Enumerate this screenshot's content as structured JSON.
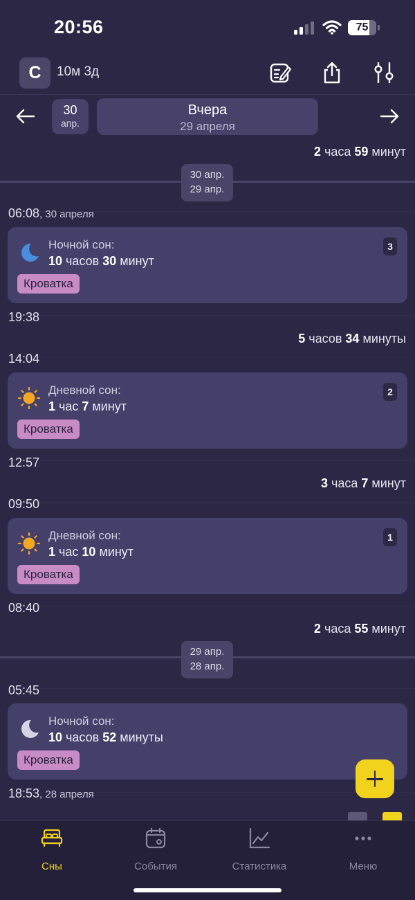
{
  "status_bar": {
    "time": "20:56",
    "battery": "75",
    "battery_level": 0.75
  },
  "header": {
    "avatar_letter": "С",
    "age": "10м 3д",
    "icons": [
      "edit-note-icon",
      "share-icon",
      "sliders-icon"
    ]
  },
  "date_nav": {
    "prev_day_num": "30",
    "prev_day_month": "апр.",
    "day_title": "Вчера",
    "day_date": "29 апреля"
  },
  "timeline": {
    "top_duration": {
      "num1": "2",
      "unit1": " часа ",
      "num2": "59",
      "unit2": " минут"
    },
    "divider1": {
      "top": "30 апр.",
      "bottom": "29 апр."
    },
    "divider2": {
      "top": "29 апр.",
      "bottom": "28 апр."
    },
    "times": [
      {
        "time": "06:08",
        "date": ", 30 апреля"
      },
      {
        "time": "19:38",
        "date": ""
      },
      {
        "time": "14:04",
        "date": ""
      },
      {
        "time": "12:57",
        "date": ""
      },
      {
        "time": "09:50",
        "date": ""
      },
      {
        "time": "08:40",
        "date": ""
      },
      {
        "time": "05:45",
        "date": ""
      },
      {
        "time": "18:53",
        "date": ", 28 апреля"
      }
    ],
    "gaps": [
      {
        "num1": "5",
        "unit1": " часов ",
        "num2": "34",
        "unit2": " минуты"
      },
      {
        "num1": "3",
        "unit1": " часа ",
        "num2": "7",
        "unit2": " минут"
      },
      {
        "num1": "2",
        "unit1": " часа ",
        "num2": "55",
        "unit2": " минут"
      }
    ],
    "cards": [
      {
        "kind": "Ночной сон:",
        "num1": "10",
        "unit1": " часов ",
        "num2": "30",
        "unit2": " минут",
        "tag": "Кроватка",
        "index": "3",
        "icon": "moon-icon"
      },
      {
        "kind": "Дневной сон:",
        "num1": "1",
        "unit1": " час ",
        "num2": "7",
        "unit2": " минут",
        "tag": "Кроватка",
        "index": "2",
        "icon": "sun-icon"
      },
      {
        "kind": "Дневной сон:",
        "num1": "1",
        "unit1": " час ",
        "num2": "10",
        "unit2": " минут",
        "tag": "Кроватка",
        "index": "1",
        "icon": "sun-icon"
      },
      {
        "kind": "Ночной сон:",
        "num1": "10",
        "unit1": " часов ",
        "num2": "52",
        "unit2": " минуты",
        "tag": "Кроватка",
        "index": "",
        "icon": "moon-icon"
      }
    ]
  },
  "tabs": [
    {
      "label": "Сны",
      "icon": "bed-icon",
      "active": true
    },
    {
      "label": "События",
      "icon": "calendar-icon",
      "active": false
    },
    {
      "label": "Статистика",
      "icon": "chart-icon",
      "active": false
    },
    {
      "label": "Меню",
      "icon": "more-icon",
      "active": false
    }
  ],
  "colors": {
    "background": "#2b2745",
    "card": "#45406a",
    "accent": "#f1d21d",
    "tag": "#c98bc5",
    "moon_blue": "#4a8de0"
  }
}
